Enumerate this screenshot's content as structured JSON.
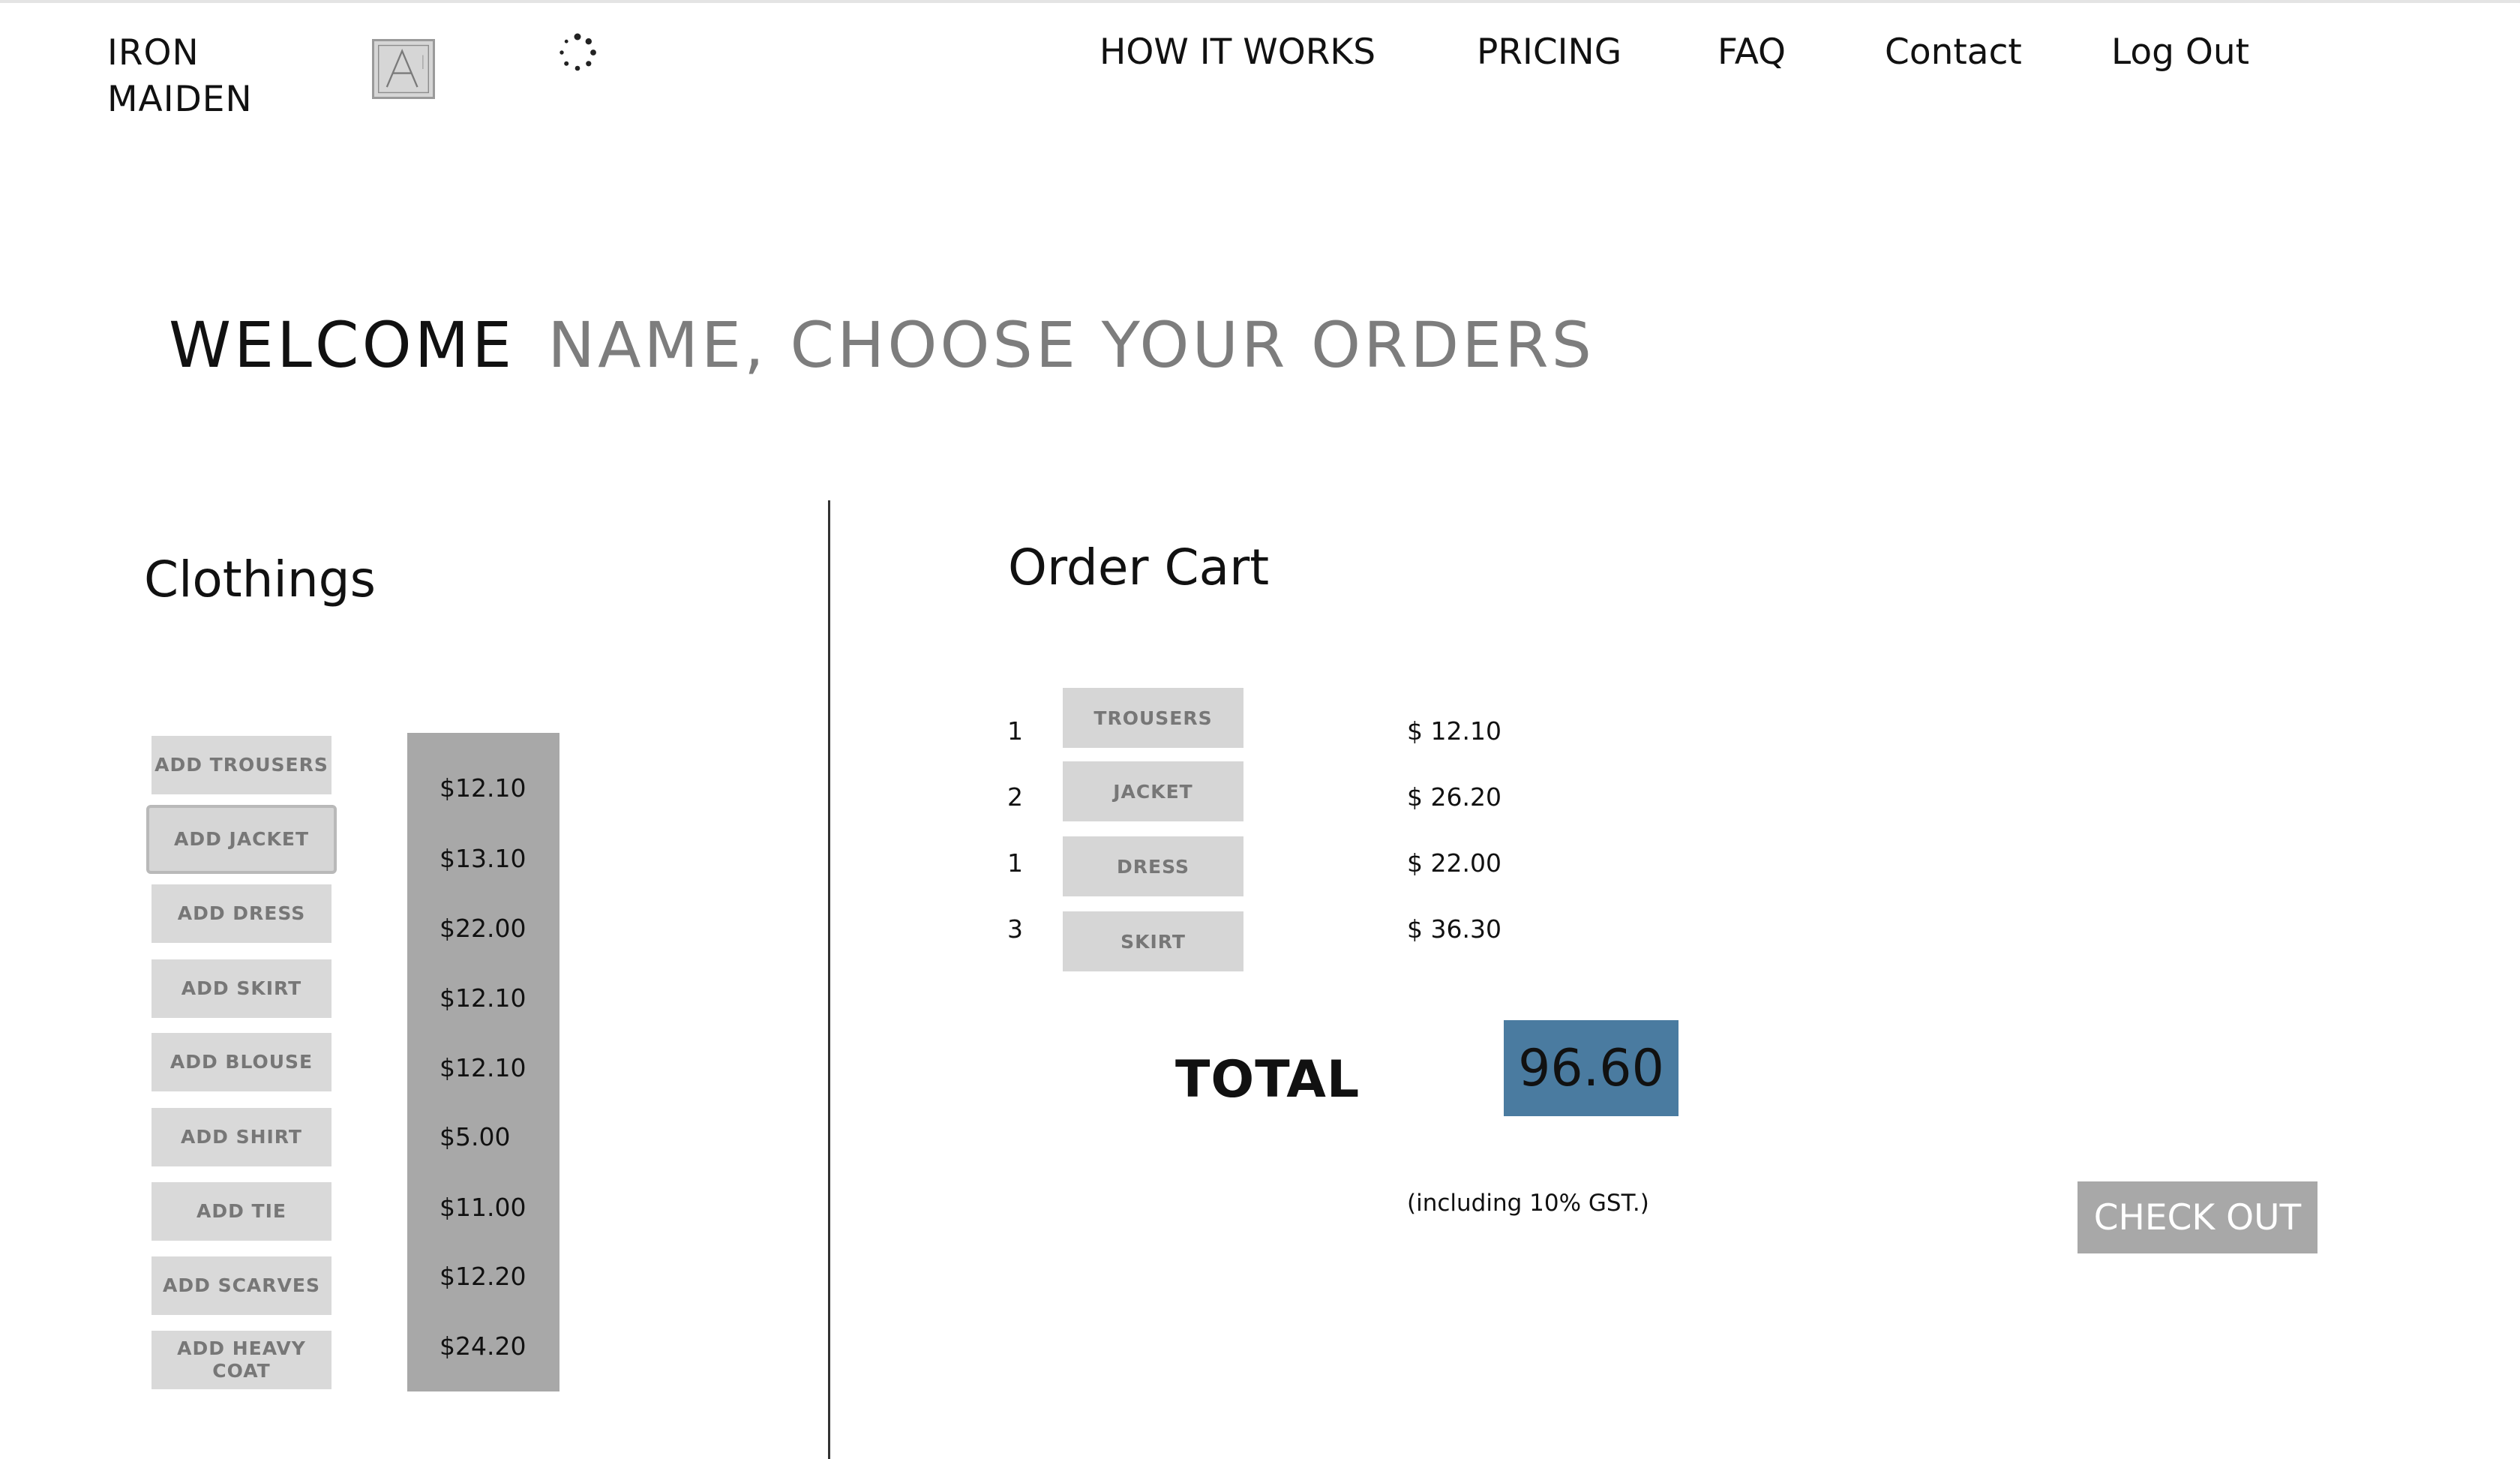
{
  "header": {
    "brand_line1": "IRON",
    "brand_line2": "MAIDEN",
    "logo_icon": "logo-a-icon",
    "spinner_icon": "loading-spinner-icon",
    "nav": [
      {
        "label": "HOW IT WORKS"
      },
      {
        "label": "PRICING"
      },
      {
        "label": "FAQ"
      },
      {
        "label": "Contact"
      },
      {
        "label": "Log Out"
      }
    ]
  },
  "welcome": {
    "greeting": "WELCOME",
    "prompt": "NAME, CHOOSE YOUR ORDERS"
  },
  "clothings": {
    "title": "Clothings",
    "items": [
      {
        "button": "ADD TROUSERS",
        "price": "$12.10"
      },
      {
        "button": "ADD JACKET",
        "price": "$13.10"
      },
      {
        "button": "ADD DRESS",
        "price": "$22.00"
      },
      {
        "button": "ADD SKIRT",
        "price": "$12.10"
      },
      {
        "button": "ADD BLOUSE",
        "price": "$12.10"
      },
      {
        "button": "ADD SHIRT",
        "price": "$5.00"
      },
      {
        "button": "ADD TIE",
        "price": "$11.00"
      },
      {
        "button": "ADD SCARVES",
        "price": "$12.20"
      },
      {
        "button": "ADD HEAVY COAT",
        "price": "$24.20"
      }
    ]
  },
  "cart": {
    "title": "Order Cart",
    "rows": [
      {
        "qty": "1",
        "item": "TROUSERS",
        "price": "$ 12.10"
      },
      {
        "qty": "2",
        "item": "JACKET",
        "price": "$ 26.20"
      },
      {
        "qty": "1",
        "item": "DRESS",
        "price": "$ 22.00"
      },
      {
        "qty": "3",
        "item": "SKIRT",
        "price": "$ 36.30"
      }
    ],
    "total_label": "TOTAL",
    "total_value": "96.60",
    "gst_note": "(including 10% GST.)",
    "checkout_label": "CHECK OUT"
  },
  "colors": {
    "total_box": "#4a7ba0",
    "price_column": "#a8a8a8",
    "button_bg": "#d9d9d9"
  }
}
